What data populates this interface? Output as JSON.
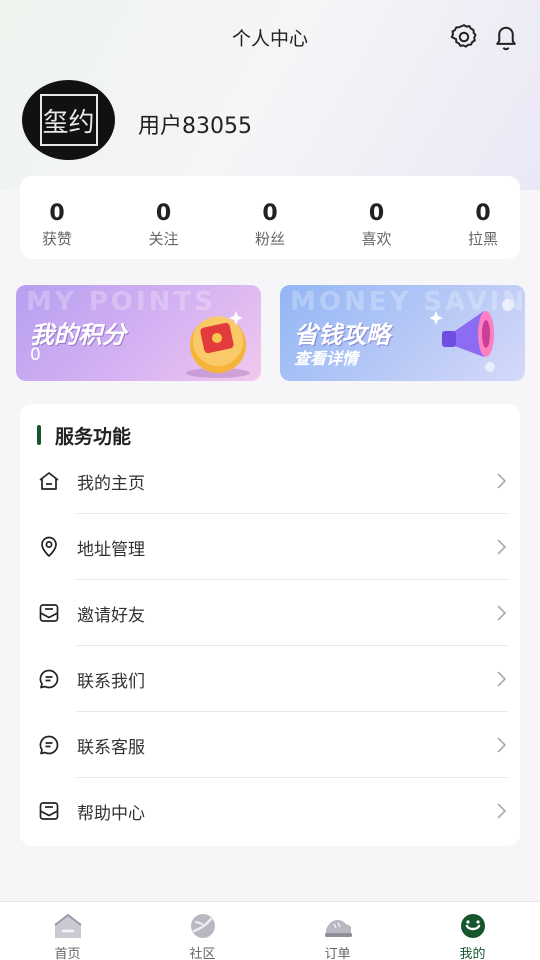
{
  "header": {
    "title": "个人中心"
  },
  "profile": {
    "avatar_text": "玺约",
    "username": "用户83055"
  },
  "stats": [
    {
      "value": "0",
      "label": "获赞"
    },
    {
      "value": "0",
      "label": "关注"
    },
    {
      "value": "0",
      "label": "粉丝"
    },
    {
      "value": "0",
      "label": "喜欢"
    },
    {
      "value": "0",
      "label": "拉黑"
    }
  ],
  "banners": {
    "points": {
      "ghost": "MY POINTS",
      "title": "我的积分",
      "value": "0"
    },
    "savings": {
      "ghost": "MONEY SAVING",
      "title": "省钱攻略",
      "subtitle": "查看详情"
    }
  },
  "services": {
    "title": "服务功能",
    "items": [
      {
        "label": "我的主页",
        "icon": "home-icon"
      },
      {
        "label": "地址管理",
        "icon": "location-icon"
      },
      {
        "label": "邀请好友",
        "icon": "mail-icon"
      },
      {
        "label": "联系我们",
        "icon": "chat-icon"
      },
      {
        "label": "联系客服",
        "icon": "chat-icon"
      },
      {
        "label": "帮助中心",
        "icon": "mail-icon"
      }
    ]
  },
  "tabbar": {
    "items": [
      {
        "label": "首页",
        "icon": "home-tab-icon"
      },
      {
        "label": "社区",
        "icon": "community-tab-icon"
      },
      {
        "label": "订单",
        "icon": "order-tab-icon"
      },
      {
        "label": "我的",
        "icon": "mine-tab-icon"
      }
    ],
    "active_index": 3
  },
  "colors": {
    "accent": "#15562d",
    "background": "#f6f6f8"
  }
}
